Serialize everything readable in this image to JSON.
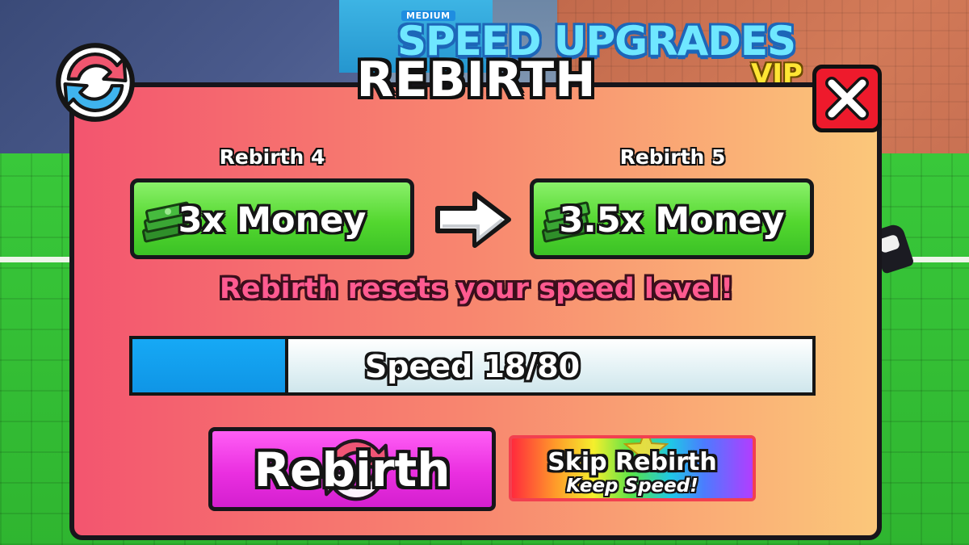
{
  "background": {
    "sign_difficulty": "MEDIUM",
    "sign_title": "SPEED UPGRADES",
    "sign_vip": "VIP"
  },
  "dialog": {
    "title": "REBIRTH",
    "current": {
      "label": "Rebirth 4",
      "reward": "3x Money"
    },
    "next": {
      "label": "Rebirth 5",
      "reward": "3.5x Money"
    },
    "warning": "Rebirth resets your speed level!",
    "progress": {
      "text": "Speed 18/80",
      "current": 18,
      "max": 80
    },
    "rebirth_button": "Rebirth",
    "skip_button": {
      "line1": "Skip Rebirth",
      "line2": "Keep Speed!"
    }
  },
  "icons": [
    "rebirth-icon",
    "close-icon",
    "cash-stack-icon",
    "arrow-right-icon",
    "star-icon"
  ],
  "colors": {
    "panel_left": "#f3556f",
    "panel_right": "#fbc77a",
    "money_green": "#53d72f",
    "progress_blue": "#0f95e6",
    "rebirth_pink": "#ea2fe0",
    "close_red": "#ee1a2c"
  }
}
